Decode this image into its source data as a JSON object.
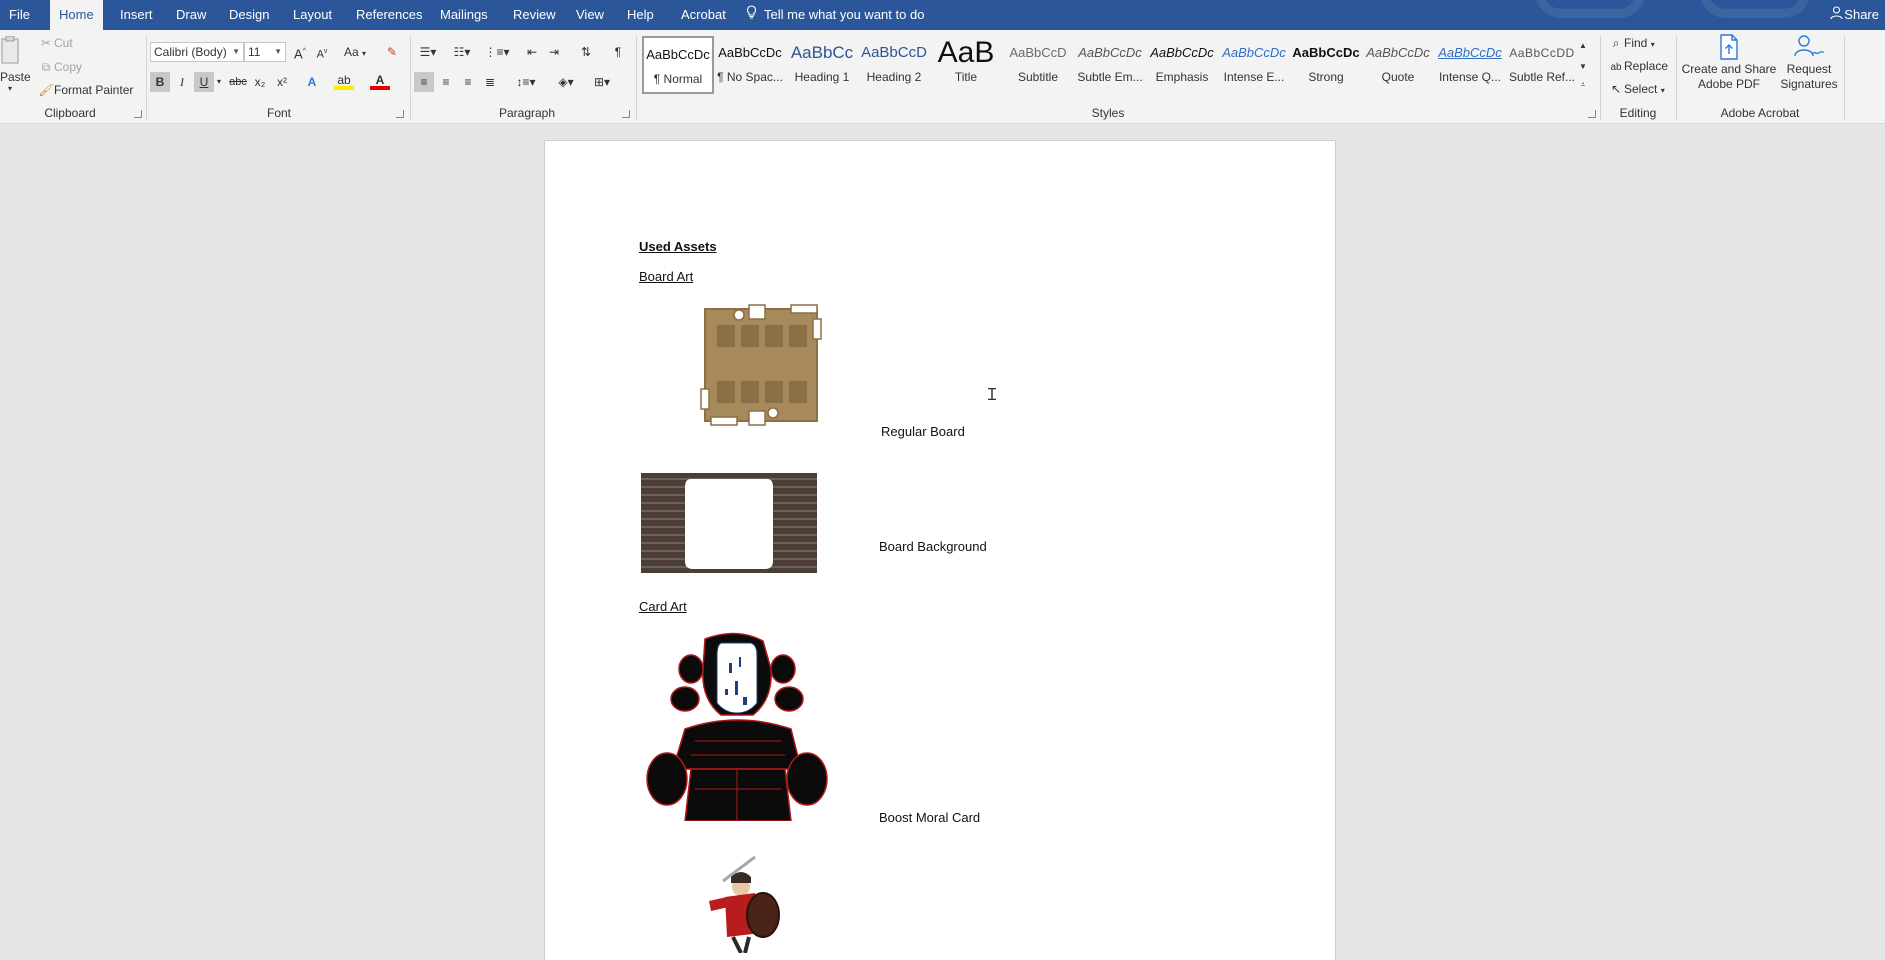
{
  "tabs": {
    "file": "File",
    "home": "Home",
    "insert": "Insert",
    "draw": "Draw",
    "design": "Design",
    "layout": "Layout",
    "references": "References",
    "mailings": "Mailings",
    "review": "Review",
    "view": "View",
    "help": "Help",
    "acrobat": "Acrobat",
    "tell_me": "Tell me what you want to do",
    "share": "Share"
  },
  "clipboard": {
    "paste": "Paste",
    "cut": "Cut",
    "copy": "Copy",
    "format_painter": "Format Painter",
    "label": "Clipboard"
  },
  "font": {
    "family": "Calibri (Body)",
    "size": "11",
    "grow": "A",
    "shrink": "A",
    "change_case": "Aa",
    "bold": "B",
    "italic": "I",
    "underline": "U",
    "strikethrough": "abc",
    "subscript": "x₂",
    "superscript": "x²",
    "text_effects": "A",
    "highlight": "ab",
    "font_color": "A",
    "label": "Font"
  },
  "paragraph": {
    "label": "Paragraph",
    "pilcrow": "¶"
  },
  "styles": {
    "label": "Styles",
    "items": [
      {
        "sample": "AaBbCcDc",
        "name": "¶ Normal"
      },
      {
        "sample": "AaBbCcDc",
        "name": "¶ No Spac..."
      },
      {
        "sample": "AaBbCc",
        "name": "Heading 1"
      },
      {
        "sample": "AaBbCcD",
        "name": "Heading 2"
      },
      {
        "sample": "AaB",
        "name": "Title"
      },
      {
        "sample": "AaBbCcD",
        "name": "Subtitle"
      },
      {
        "sample": "AaBbCcDc",
        "name": "Subtle Em..."
      },
      {
        "sample": "AaBbCcDc",
        "name": "Emphasis"
      },
      {
        "sample": "AaBbCcDc",
        "name": "Intense E..."
      },
      {
        "sample": "AaBbCcDc",
        "name": "Strong"
      },
      {
        "sample": "AaBbCcDc",
        "name": "Quote"
      },
      {
        "sample": "AaBbCcDc",
        "name": "Intense Q..."
      },
      {
        "sample": "AaBbCcDD",
        "name": "Subtle Ref..."
      }
    ]
  },
  "editing": {
    "find": "Find",
    "replace": "Replace",
    "select": "Select",
    "label": "Editing"
  },
  "acrobat_group": {
    "create_share": "Create and Share",
    "adobe_pdf": "Adobe PDF",
    "request": "Request",
    "signatures": "Signatures",
    "label": "Adobe Acrobat"
  },
  "document": {
    "heading": "Used Assets",
    "section_board": "Board Art",
    "caption_regular": "Regular Board",
    "caption_background": "Board Background",
    "section_card": "Card Art",
    "caption_boost": "Boost Moral Card"
  },
  "colors": {
    "accent": "#2b579a",
    "board_tan": "#a78a5c",
    "board_dark": "#8b6f45",
    "plank_dark": "#4a3e36"
  }
}
